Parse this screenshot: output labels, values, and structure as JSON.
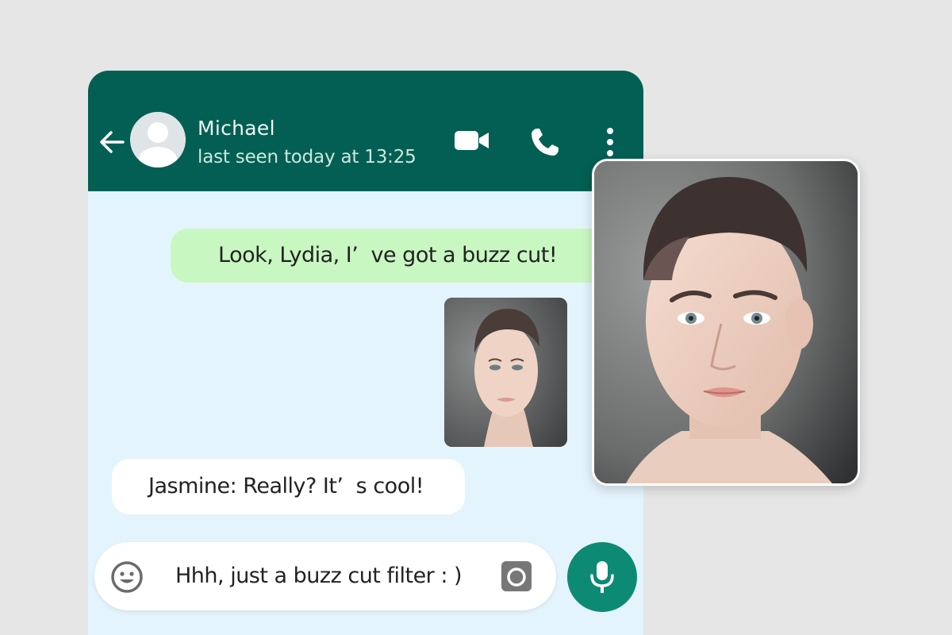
{
  "header": {
    "contact_name": "Michael",
    "status": "last seen today at 13:25",
    "icons": [
      "back-arrow-icon",
      "video-call-icon",
      "phone-call-icon",
      "more-options-icon"
    ]
  },
  "messages": [
    {
      "direction": "outgoing",
      "text": "Look, Lydia, I’  ve got a buzz cut!"
    },
    {
      "direction": "outgoing",
      "type": "image",
      "content": "portrait-buzz-cut-photo"
    },
    {
      "direction": "incoming",
      "text": "Jasmine: Really? It’  s cool!"
    }
  ],
  "composer": {
    "text": "Hhh, just a buzz cut filter : )",
    "icons": [
      "emoji-icon",
      "camera-icon",
      "microphone-icon"
    ]
  },
  "colors": {
    "header": "#035f53",
    "chat_background": "#e4f4fc",
    "outgoing_bubble": "#c9f7c2",
    "incoming_bubble": "#ffffff",
    "mic_button": "#0d8a74",
    "page_background": "#e6e6e6"
  }
}
